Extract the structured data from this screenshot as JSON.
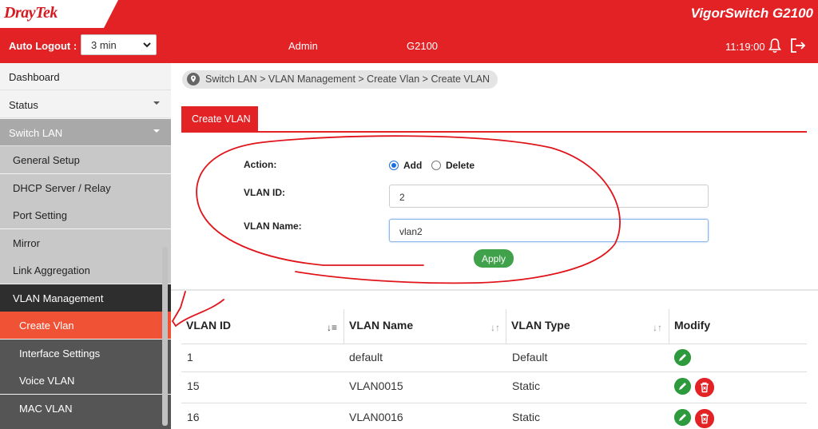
{
  "header": {
    "brand": "DrayTek",
    "product": "VigorSwitch G2100",
    "auto_logout_label": "Auto Logout :",
    "auto_logout_value": "3 min",
    "user": "Admin",
    "model": "G2100",
    "time": "11:19:00",
    "icons": [
      "bell-icon",
      "logout-icon"
    ]
  },
  "sidebar": {
    "items": [
      {
        "label": "Dashboard"
      },
      {
        "label": "Status"
      },
      {
        "label": "Switch LAN"
      },
      {
        "label": "General Setup"
      },
      {
        "label": "DHCP Server / Relay"
      },
      {
        "label": "Port Setting"
      },
      {
        "label": "Mirror"
      },
      {
        "label": "Link Aggregation"
      },
      {
        "label": "VLAN Management"
      },
      {
        "label": "Create Vlan"
      },
      {
        "label": "Interface Settings"
      },
      {
        "label": "Voice VLAN"
      },
      {
        "label": "MAC VLAN"
      }
    ]
  },
  "breadcrumb": "Switch LAN > VLAN Management > Create Vlan  > Create VLAN",
  "tab": "Create VLAN",
  "form": {
    "action_label": "Action:",
    "action_add": "Add",
    "action_delete": "Delete",
    "action_selected": "Add",
    "vlan_id_label": "VLAN ID:",
    "vlan_id_value": "2",
    "vlan_name_label": "VLAN Name:",
    "vlan_name_value": "vlan2",
    "apply": "Apply"
  },
  "table": {
    "headers": [
      "VLAN ID",
      "VLAN Name",
      "VLAN Type",
      "Modify"
    ],
    "rows": [
      {
        "id": "1",
        "name": "default",
        "type": "Default"
      },
      {
        "id": "15",
        "name": "VLAN0015",
        "type": "Static"
      },
      {
        "id": "16",
        "name": "VLAN0016",
        "type": "Static"
      }
    ]
  },
  "colors": {
    "brand_red": "#e32226",
    "active_item": "#f05236",
    "apply_green": "#3fa14a",
    "annotation": "#e0141a"
  }
}
